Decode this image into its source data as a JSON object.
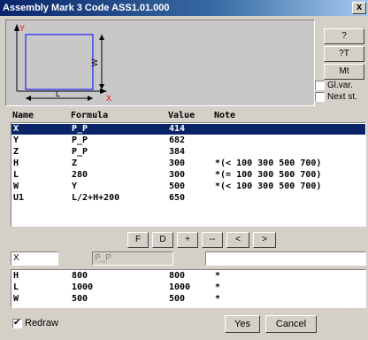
{
  "window": {
    "title": "Assembly Mark 3 Code ASS1.01.000",
    "close_label": "x"
  },
  "preview": {
    "axis_y": "Y",
    "axis_x": "X",
    "dim_w": "W",
    "dim_l": "L"
  },
  "side_buttons": [
    "?",
    "?T",
    "Mt"
  ],
  "checkboxes": [
    {
      "label": "Gl.var.",
      "checked": false
    },
    {
      "label": "Next st.",
      "checked": false
    }
  ],
  "columns": [
    "Name",
    "Formula",
    "Value",
    "Note"
  ],
  "rows": [
    {
      "name": "X",
      "formula": "P_P",
      "value": "414",
      "note": ""
    },
    {
      "name": "Y",
      "formula": "P_P",
      "value": "682",
      "note": ""
    },
    {
      "name": "Z",
      "formula": "P_P",
      "value": "384",
      "note": ""
    },
    {
      "name": "H",
      "formula": "Z",
      "value": "300",
      "note": "*(< 100 300 500 700)"
    },
    {
      "name": "L",
      "formula": "280",
      "value": "300",
      "note": "*(= 100 300 500 700)"
    },
    {
      "name": "W",
      "formula": "Y",
      "value": "500",
      "note": "*(< 100 300 500 700)"
    },
    {
      "name": "U1",
      "formula": "L/2+H+200",
      "value": "650",
      "note": ""
    }
  ],
  "controls": [
    "F",
    "D",
    "+",
    "--",
    "<",
    ">"
  ],
  "edit": {
    "name": "X",
    "formula": "P_P",
    "note": ""
  },
  "rows2": [
    {
      "name": "H",
      "formula": "800",
      "value": "800",
      "note": "*"
    },
    {
      "name": "L",
      "formula": "1000",
      "value": "1000",
      "note": "*"
    },
    {
      "name": "W",
      "formula": "500",
      "value": "500",
      "note": "*"
    }
  ],
  "footer": {
    "redraw_label": "Redraw",
    "redraw_checked": true,
    "yes_label": "Yes",
    "cancel_label": "Cancel"
  },
  "colors": {
    "selection": "#0a246a",
    "title_start": "#0a246a",
    "title_end": "#a6caf0",
    "line_blue": "#0000ff"
  }
}
